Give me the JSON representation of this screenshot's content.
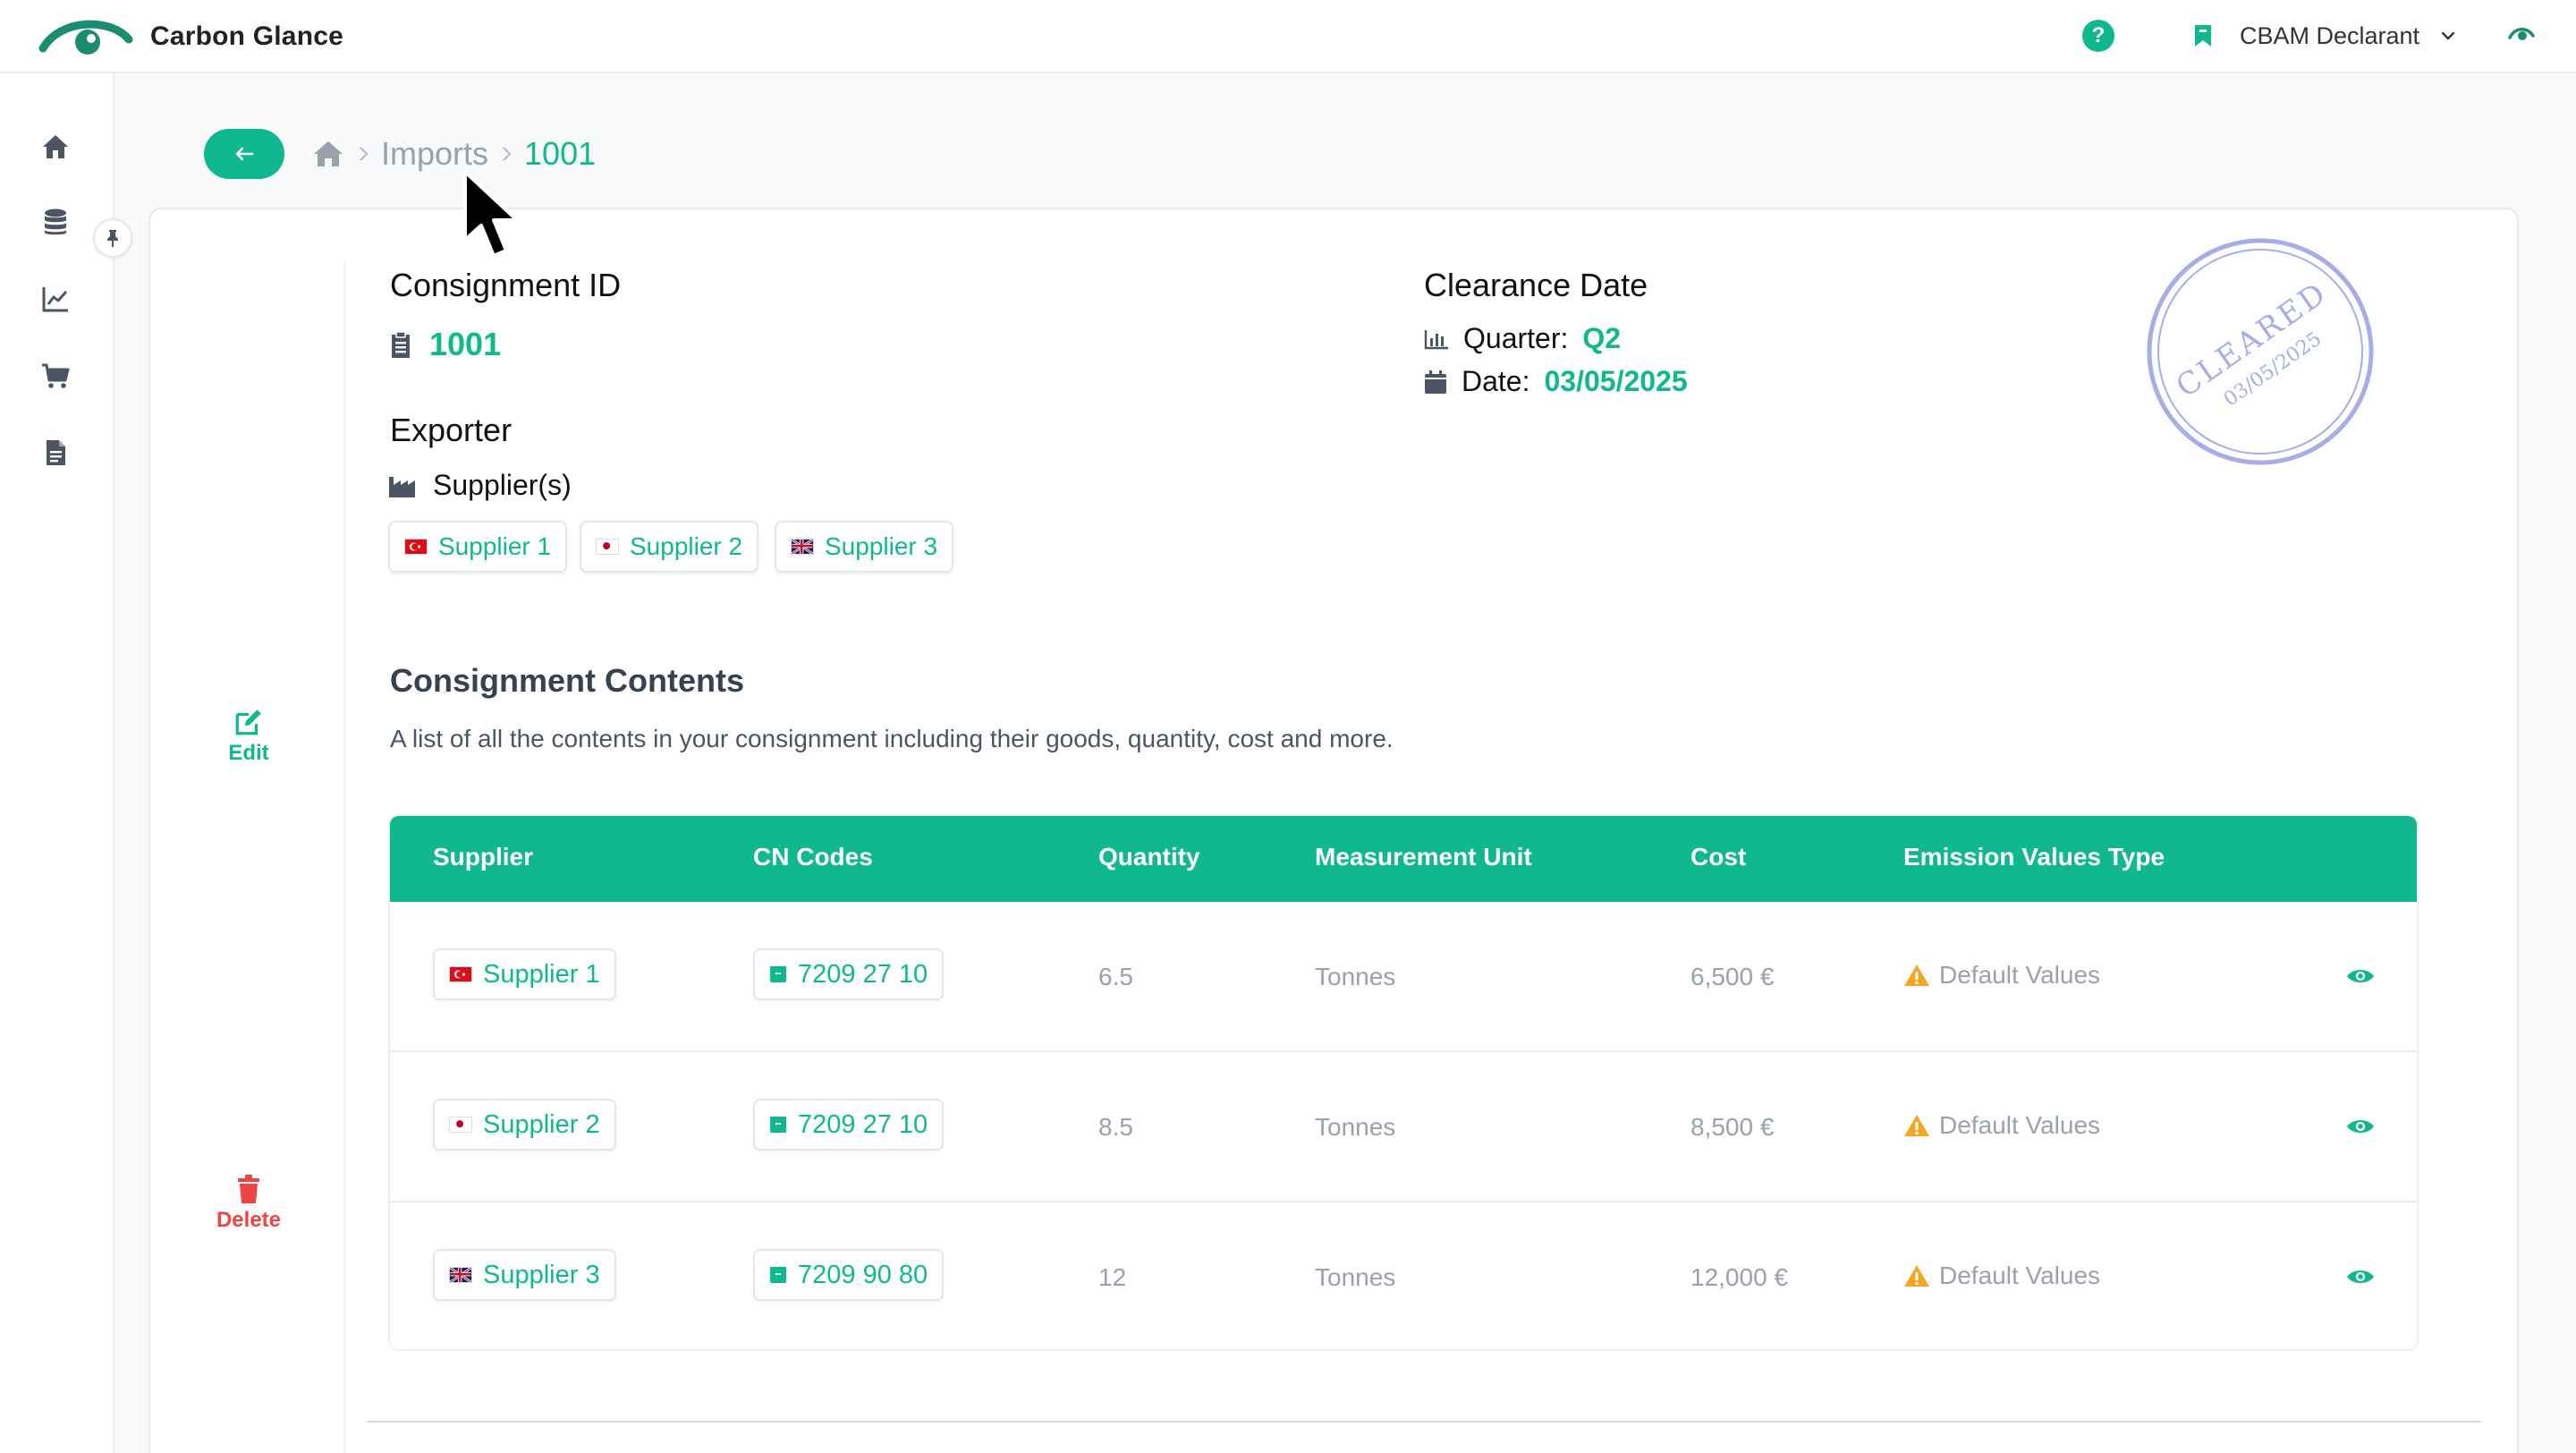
{
  "app": {
    "name": "Carbon Glance"
  },
  "header": {
    "help_icon": "question-circle-icon",
    "user_role": "CBAM Declarant"
  },
  "breadcrumb": {
    "section": "Imports",
    "current": "1001"
  },
  "consignment": {
    "id_label": "Consignment ID",
    "id_value": "1001",
    "exporter_label": "Exporter",
    "suppliers_label": "Supplier(s)",
    "suppliers": [
      {
        "name": "Supplier 1",
        "flag": "turkey"
      },
      {
        "name": "Supplier 2",
        "flag": "japan"
      },
      {
        "name": "Supplier 3",
        "flag": "united-kingdom"
      }
    ]
  },
  "clearance": {
    "label": "Clearance Date",
    "quarter_label": "Quarter:",
    "quarter_value": "Q2",
    "date_label": "Date:",
    "date_value": "03/05/2025"
  },
  "stamp": {
    "text": "CLEARED",
    "date": "03/05/2025",
    "color": "#a5aee6"
  },
  "actions": {
    "edit": "Edit",
    "delete": "Delete"
  },
  "contents": {
    "title": "Consignment Contents",
    "description": "A list of all the contents in your consignment including their goods, quantity, cost and more."
  },
  "table": {
    "headers": [
      "Supplier",
      "CN Codes",
      "Quantity",
      "Measurement Unit",
      "Cost",
      "Emission Values Type"
    ],
    "rows": [
      {
        "supplier": "Supplier 1",
        "flag": "turkey",
        "cn_code": "7209 27 10",
        "quantity": "6.5",
        "unit": "Tonnes",
        "cost": "6,500 €",
        "emission": "Default Values"
      },
      {
        "supplier": "Supplier 2",
        "flag": "japan",
        "cn_code": "7209 27 10",
        "quantity": "8.5",
        "unit": "Tonnes",
        "cost": "8,500 €",
        "emission": "Default Values"
      },
      {
        "supplier": "Supplier 3",
        "flag": "united-kingdom",
        "cn_code": "7209 90 80",
        "quantity": "12",
        "unit": "Tonnes",
        "cost": "12,000 €",
        "emission": "Default Values"
      }
    ]
  },
  "colors": {
    "accent": "#0fb88f",
    "danger": "#ef4444",
    "warning": "#f5a623",
    "muted": "#9aa1aa"
  }
}
